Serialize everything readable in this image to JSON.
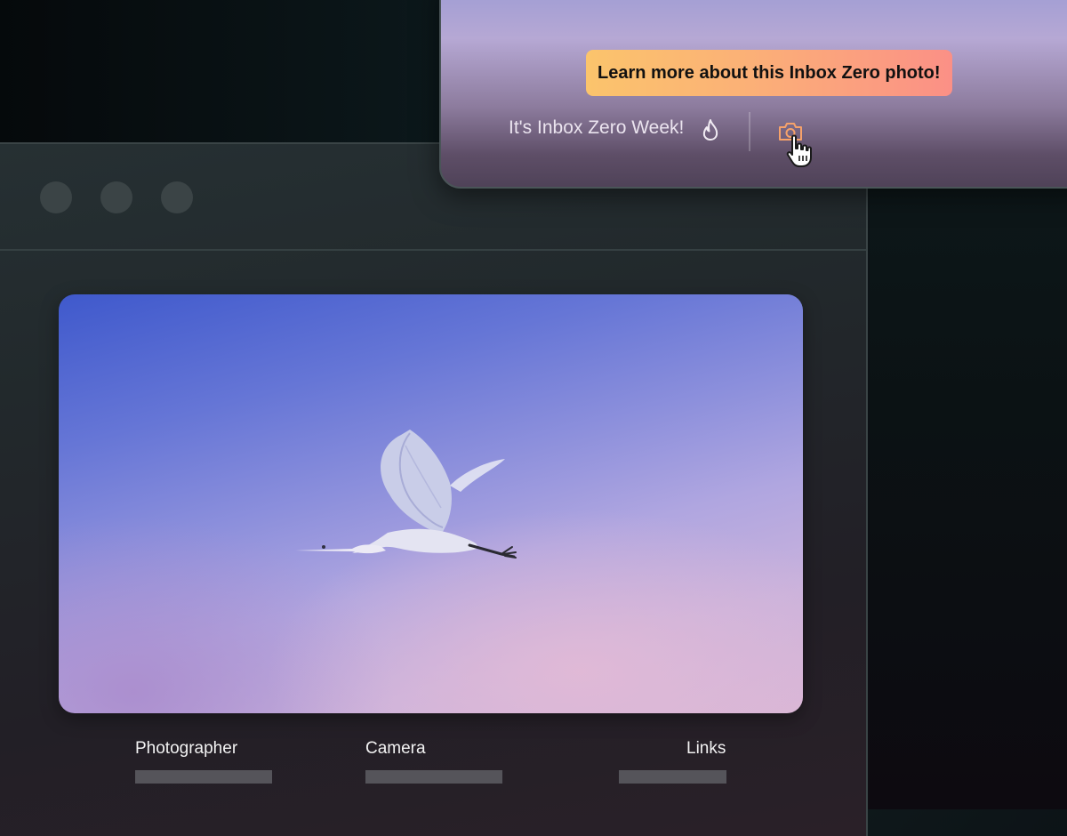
{
  "overlay": {
    "tooltip": "Learn more about this Inbox Zero photo!",
    "greeting": "It's Inbox Zero Week!",
    "icons": [
      "flame-icon",
      "camera-icon",
      "pointer-cursor-icon"
    ]
  },
  "window": {
    "controls": [
      "window-dot",
      "window-dot",
      "window-dot"
    ]
  },
  "photo": {
    "subject": "egret-in-flight"
  },
  "meta": {
    "photographer_label": "Photographer",
    "camera_label": "Camera",
    "links_label": "Links"
  },
  "colors": {
    "tooltip_start": "#fbc46c",
    "tooltip_end": "#fb9086",
    "camera_icon": "#f6a26a"
  }
}
